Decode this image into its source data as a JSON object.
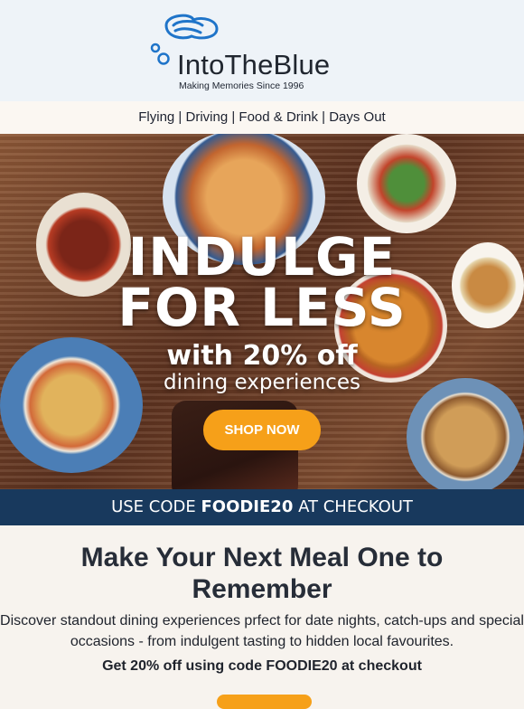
{
  "brand": {
    "name": "IntoTheBlue",
    "tagline": "Making Memories Since 1996"
  },
  "nav": {
    "items": [
      "Flying",
      "Driving",
      "Food & Drink",
      "Days Out"
    ],
    "separator": " | "
  },
  "hero": {
    "headline_line1": "INDULGE",
    "headline_line2": "FOR LESS",
    "subline_1": "with 20% off",
    "subline_2": "dining experiences",
    "cta_label": "SHOP NOW",
    "code_text_prefix": "USE CODE ",
    "code": "FOODIE20",
    "code_text_suffix": " AT CHECKOUT"
  },
  "content": {
    "title": "Make Your Next Meal One to Remember",
    "body": "Discover standout dining experiences prfect for date nights, catch-ups and special occasions - from indulgent tasting to hidden local favourites.",
    "promo": "Get 20% off using code FOODIE20 at checkout"
  },
  "colors": {
    "accent_orange": "#f6a019",
    "code_bar_blue": "#18395d",
    "brand_blue": "#1f74c9"
  }
}
